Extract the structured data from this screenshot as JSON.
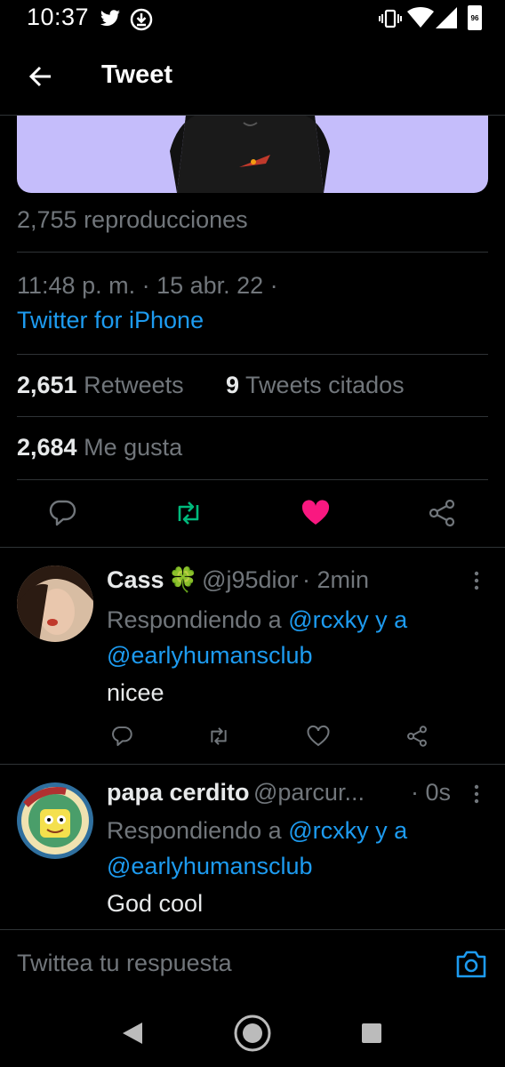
{
  "status_bar": {
    "time": "10:37",
    "battery": "96",
    "icons": [
      "twitter-bird-icon",
      "download-icon",
      "vibrate-icon",
      "wifi-icon",
      "signal-icon",
      "battery-icon"
    ]
  },
  "header": {
    "title": "Tweet",
    "back_icon": "arrow-left-icon"
  },
  "tweet": {
    "views": "2,755 reproducciones",
    "timestamp": "11:48 p. m. · 15 abr. 22 ·",
    "client": "Twitter for iPhone",
    "retweets_count": "2,651",
    "retweets_label": "Retweets",
    "quotes_count": "9",
    "quotes_label": "Tweets citados",
    "likes_count": "2,684",
    "likes_label": "Me gusta",
    "actions": [
      "reply-icon",
      "retweet-icon",
      "like-icon",
      "share-icon"
    ],
    "colors": {
      "retweet": "#00ba7c",
      "like": "#f91880",
      "link": "#1d9bf0",
      "media_bg": "#c5bdfb"
    }
  },
  "replies": [
    {
      "name": "Cass",
      "emoji": "🍀",
      "handle": "@j95dior",
      "time": "· 2min",
      "replying_prefix": "Respondiendo a",
      "mention1": "@rcxky",
      "joiner": "y a",
      "mention2": "@earlyhumansclub",
      "text": "nicee"
    },
    {
      "name": "papa cerdito",
      "handle": "@parcur...",
      "time": "· 0s",
      "replying_prefix": "Respondiendo a",
      "mention1": "@rcxky",
      "joiner": "y a",
      "mention2": "@earlyhumansclub",
      "text": "God cool"
    }
  ],
  "reply_box": {
    "placeholder": "Twittea tu respuesta",
    "camera_icon": "camera-icon"
  },
  "nav_bar": {
    "icons": [
      "back-triangle-icon",
      "home-circle-icon",
      "recents-square-icon"
    ]
  }
}
